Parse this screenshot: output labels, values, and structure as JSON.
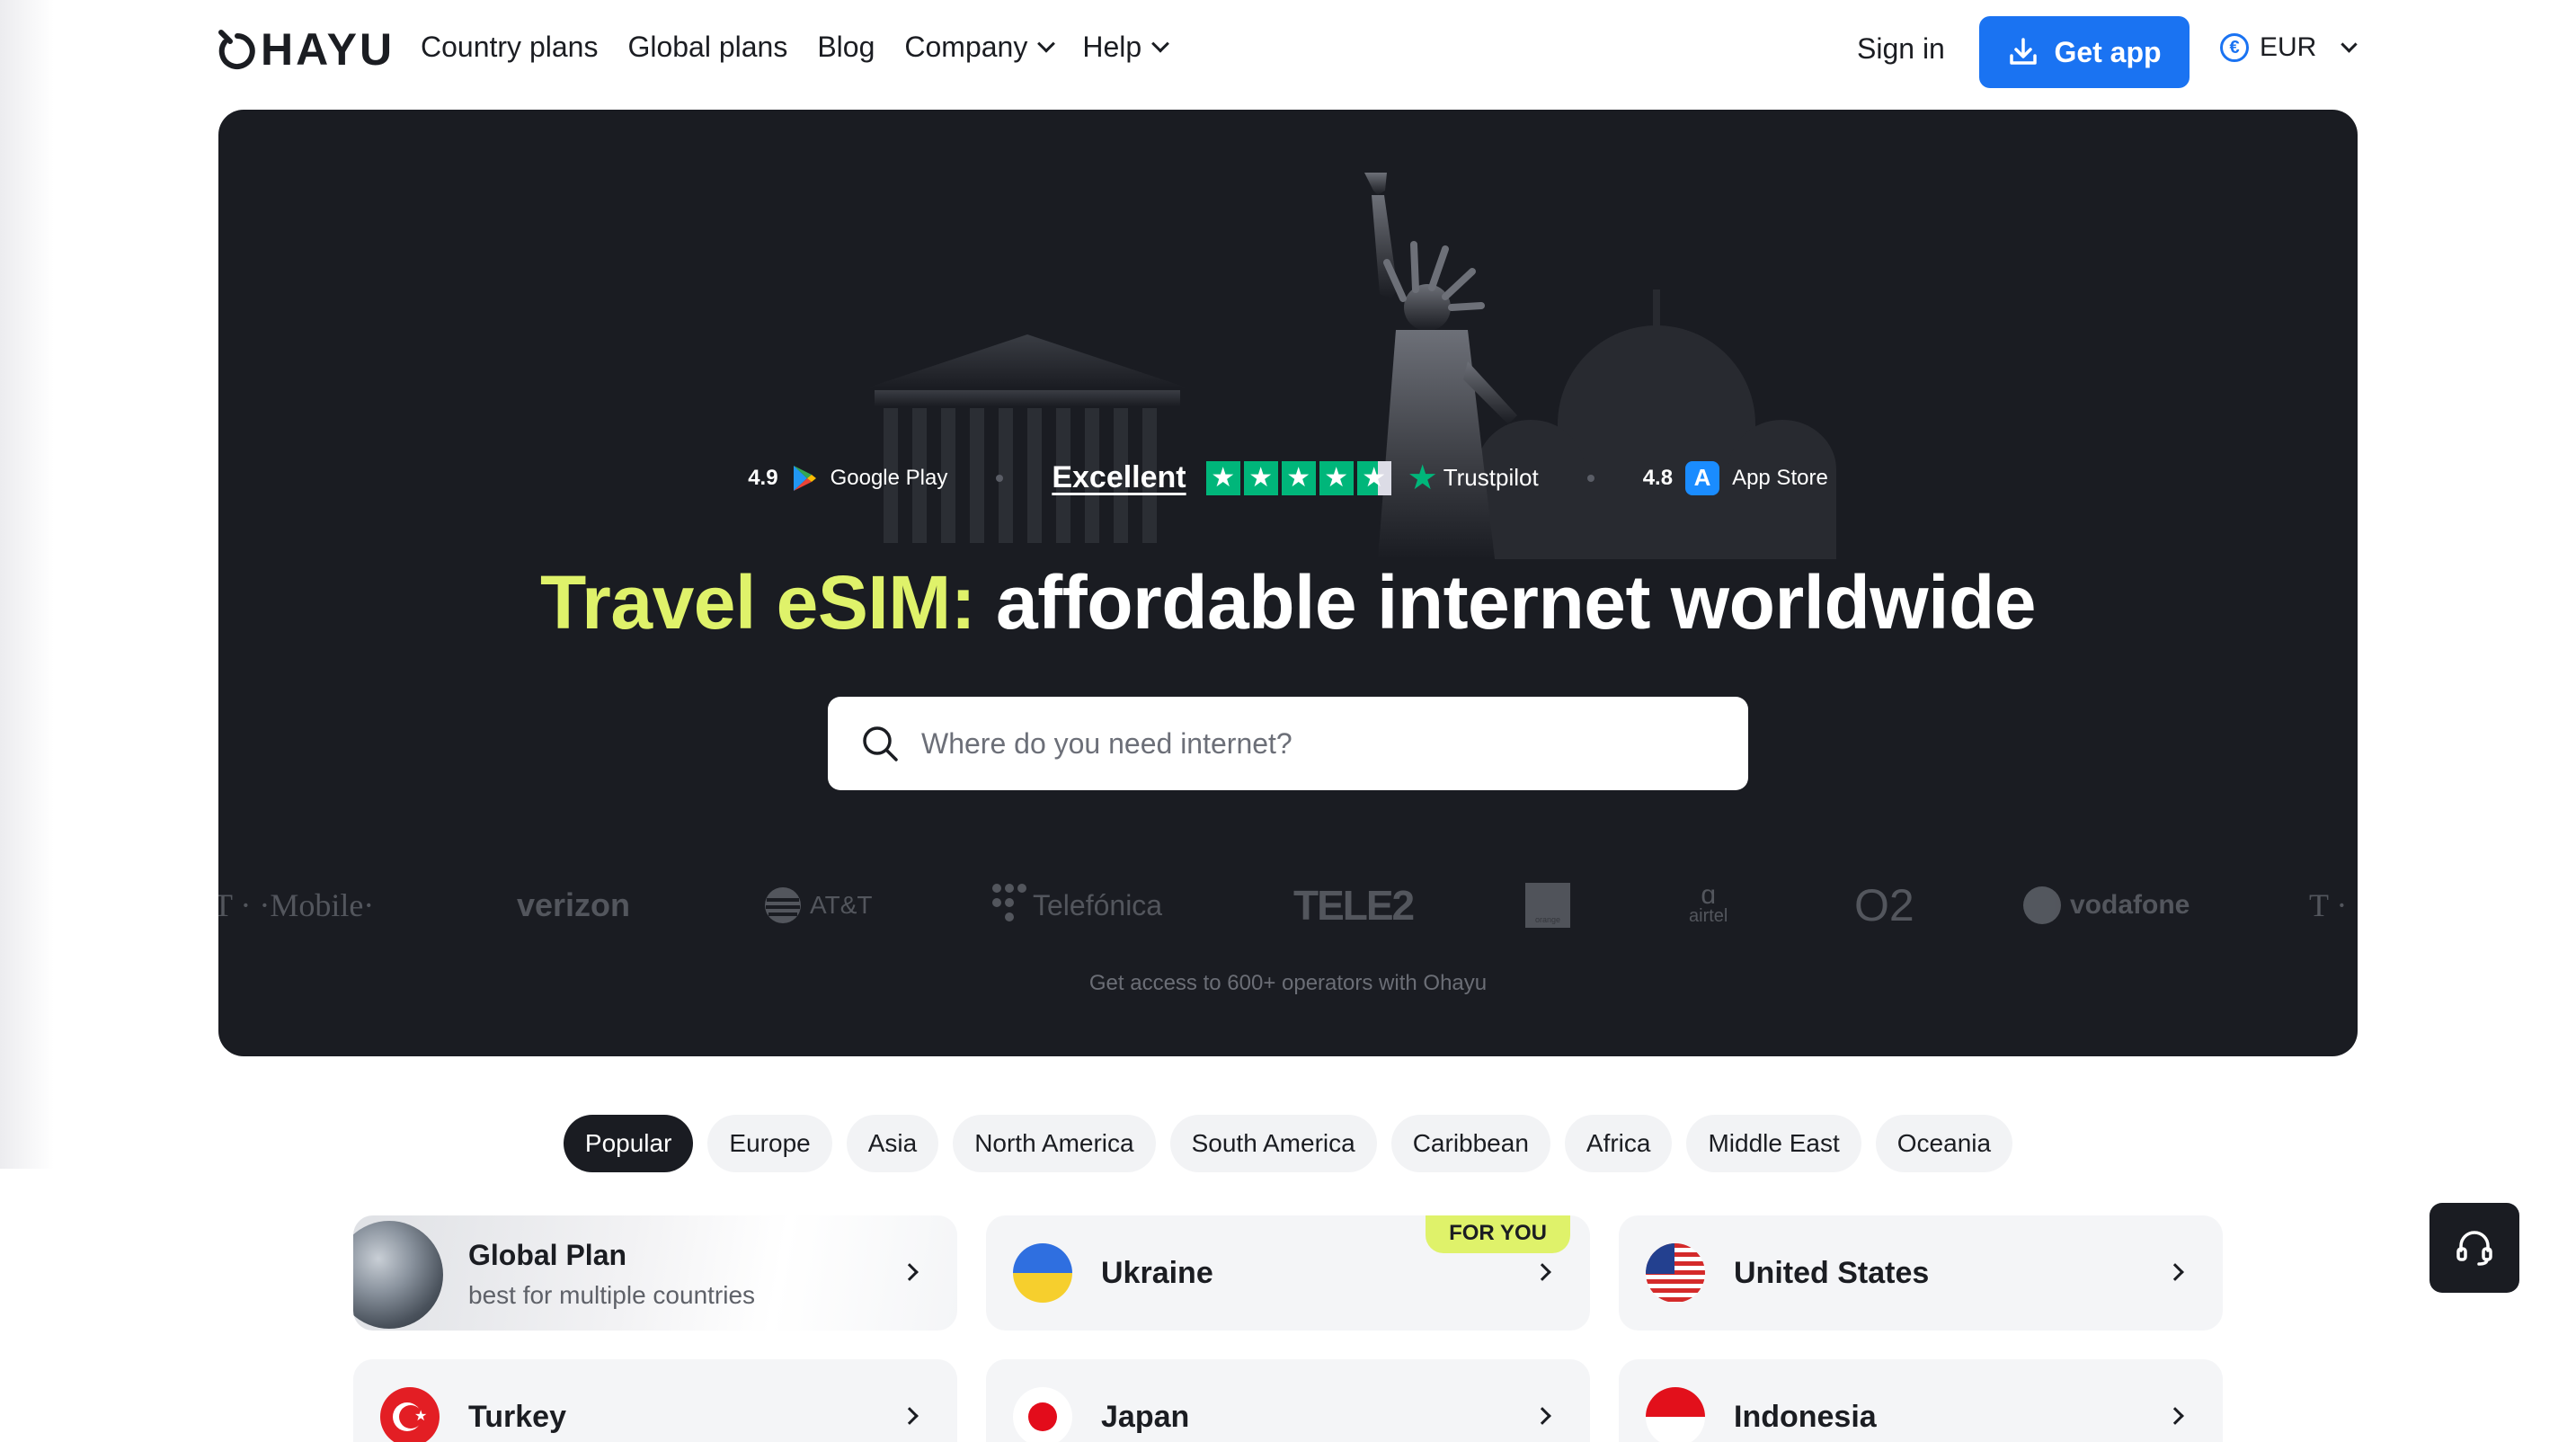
{
  "brand": {
    "logo_text": "HAYU"
  },
  "nav": {
    "items": [
      {
        "label": "Country plans",
        "has_dropdown": false
      },
      {
        "label": "Global plans",
        "has_dropdown": false
      },
      {
        "label": "Blog",
        "has_dropdown": false
      },
      {
        "label": "Company",
        "has_dropdown": true
      },
      {
        "label": "Help",
        "has_dropdown": true
      }
    ],
    "sign_in": "Sign in",
    "get_app": "Get app",
    "currency": "EUR"
  },
  "hero": {
    "ratings": {
      "google_play": {
        "score": "4.9",
        "label": "Google Play"
      },
      "trustpilot": {
        "excellent": "Excellent",
        "brand": "Trustpilot",
        "stars": 4.5
      },
      "app_store": {
        "score": "4.8",
        "label": "App Store"
      }
    },
    "title_accent": "Travel eSIM:",
    "title_rest": "affordable internet worldwide",
    "search_placeholder": "Where do you need internet?",
    "operators": [
      "T · ·Mobile·",
      "verizon",
      "AT&T",
      "Telefónica",
      "TELE2",
      "orange",
      "airtel",
      "O2",
      "vodafone",
      "T ·"
    ],
    "operators_caption": "Get access to 600+ operators with Ohayu"
  },
  "regions": {
    "active": "Popular",
    "tabs": [
      "Popular",
      "Europe",
      "Asia",
      "North America",
      "South America",
      "Caribbean",
      "Africa",
      "Middle East",
      "Oceania"
    ]
  },
  "plans": {
    "global": {
      "title": "Global Plan",
      "subtitle": "best for multiple countries"
    },
    "countries": [
      {
        "name": "Ukraine",
        "badge": "FOR YOU"
      },
      {
        "name": "United States",
        "badge": ""
      },
      {
        "name": "Turkey",
        "badge": ""
      },
      {
        "name": "Japan",
        "badge": ""
      },
      {
        "name": "Indonesia",
        "badge": ""
      }
    ]
  },
  "colors": {
    "accent_blue": "#1a73f2",
    "hero_bg": "#1a1c22",
    "accent_lime": "#dff26a",
    "trustpilot_green": "#00b67a"
  },
  "icons": {
    "search": "search-icon",
    "download": "download-icon",
    "currency": "euro-coin-icon",
    "support": "headset-icon"
  }
}
